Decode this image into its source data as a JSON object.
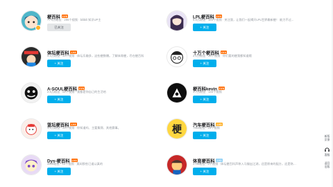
{
  "cards": [
    {
      "name": "梗百科",
      "level": "LV6",
      "level_color": "#ff6c00",
      "desc": "77.4万粉丝 · 296个视频 · bilibili 知识UP主",
      "button": "已关注",
      "followed": true,
      "avatar_icon": "anime-face-icon"
    },
    {
      "name": "LPL梗百科",
      "level": "LV4",
      "level_color": "#ff6c00",
      "desc": "9.8万粉丝 · 164个视频 · 关注我，让我们一起揭开LPL世界最新梗！ 能力不过...",
      "button": "+ 关注",
      "followed": false,
      "avatar_icon": "anime-girl-icon"
    },
    {
      "name": "体坛梗百科",
      "level": "LV4",
      "level_color": "#ff6c00",
      "desc": "4.3万粉丝 · 43个视频 · 体坛乐趣多，这些梗数爆。了解体育梗，尽在梗百科",
      "button": "+ 关注",
      "followed": false,
      "avatar_icon": "sports-avatar-icon"
    },
    {
      "name": "十万个梗百科",
      "level": "LV4",
      "level_color": "#ff6c00",
      "desc": "2.1万粉丝 · 46个视频 · 你们要的梗我都知道哦",
      "button": "+ 关注",
      "followed": false,
      "avatar_icon": "glasses-avatar-icon"
    },
    {
      "name": "A-SOUL梗百科",
      "level": "LV4",
      "level_color": "#ff6c00",
      "desc": "2.6万粉丝 · 61个视频 · 我都是你自己的生活哈",
      "button": "+ 关注",
      "followed": false,
      "avatar_icon": "asoul-avatar-icon"
    },
    {
      "name": "梗百科kevin",
      "level": "LV4",
      "level_color": "#ff6c00",
      "desc": "1.7万粉丝 · 134个视频",
      "button": "+ 关注",
      "followed": false,
      "avatar_icon": "kevin-avatar-icon"
    },
    {
      "name": "篮坛梗百科",
      "level": "LV4",
      "level_color": "#ff6c00",
      "desc": "1.2万粉丝 · 23个视频 · 你知道吗、主要集锦、其他赛事。",
      "button": "+ 关注",
      "followed": false,
      "avatar_icon": "basketball-avatar-icon"
    },
    {
      "name": "汽车梗百科",
      "level": "LV3",
      "level_color": "#ffb027",
      "desc": "7864粉丝 · 19个视频",
      "button": "+ 关注",
      "followed": false,
      "avatar_icon": "geng-text-avatar-icon"
    },
    {
      "name": "Dys-梗百科",
      "level": "LV4",
      "level_color": "#ff6c00",
      "desc": "3909粉丝 · 43个视频 · 莫闲那些已道认真的",
      "button": "+ 关注",
      "followed": false,
      "avatar_icon": "purple-avatar-icon"
    },
    {
      "name": "体育梗百科",
      "level": "LV2",
      "level_color": "#8fd0f5",
      "desc": "2798粉丝 · 5个视频 · 体坛梗百科声称入马服出江湖，还是原来的配方，还是熟悉的...",
      "button": "+ 关注",
      "followed": false,
      "avatar_icon": "sports-fan-avatar-icon"
    }
  ],
  "sidebar": {
    "new_version": "新版\n反馈",
    "service": "客服",
    "back_old": "返回\n旧版"
  }
}
